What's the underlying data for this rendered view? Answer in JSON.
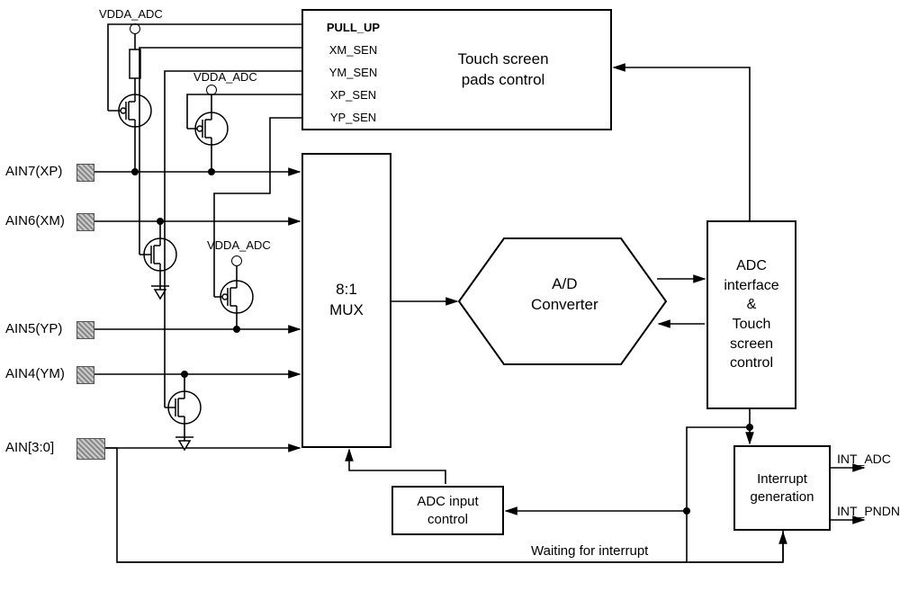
{
  "labels": {
    "vdda_top": "VDDA_ADC",
    "vdda_mid": "VDDA_ADC",
    "vdda_low": "VDDA_ADC",
    "pull_up": "PULL_UP",
    "xm_sen": "XM_SEN",
    "ym_sen": "YM_SEN",
    "xp_sen": "XP_SEN",
    "yp_sen": "YP_SEN",
    "ain7": "AIN7(XP)",
    "ain6": "AIN6(XM)",
    "ain5": "AIN5(YP)",
    "ain4": "AIN4(YM)",
    "ain30": "AIN[3:0]",
    "mux": "8:1\nMUX",
    "adconv": "A/D\nConverter",
    "adcif": "ADC\ninterface\n&\nTouch\nscreen\ncontrol",
    "tspads": "Touch screen\npads control",
    "adcin": "ADC input\ncontrol",
    "intgen": "Interrupt\ngeneration",
    "int_adc": "INT_ADC",
    "int_pnd": "INT_PNDNUP",
    "waiting": "Waiting for interrupt"
  }
}
